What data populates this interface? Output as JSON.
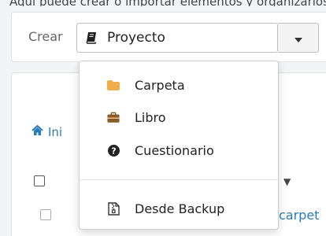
{
  "top_partial_text": "Aquí puede crear o importar elementos y organizarlos en carpetas",
  "create": {
    "label": "Crear",
    "selected": "Proyecto",
    "selected_icon": "book-icon",
    "caret_icon": "caret-down-icon"
  },
  "menu": {
    "items": [
      {
        "label": "Carpeta",
        "icon": "folder-icon",
        "color": "#f0ad4e"
      },
      {
        "label": "Libro",
        "icon": "briefcase-icon",
        "color": "#8a5a2b"
      },
      {
        "label": "Cuestionario",
        "icon": "question-circle-icon",
        "color": "#222222"
      }
    ],
    "backup": {
      "label": "Desde Backup",
      "icon": "file-archive-icon"
    }
  },
  "breadcrumb": {
    "home_label": "Ini",
    "icon": "home-icon"
  },
  "table": {
    "sort_arrow": "▼",
    "row_link": "carpet"
  },
  "colors": {
    "link": "#2a7ab8",
    "folder": "#f0ad4e",
    "briefcase": "#8a5a2b"
  }
}
